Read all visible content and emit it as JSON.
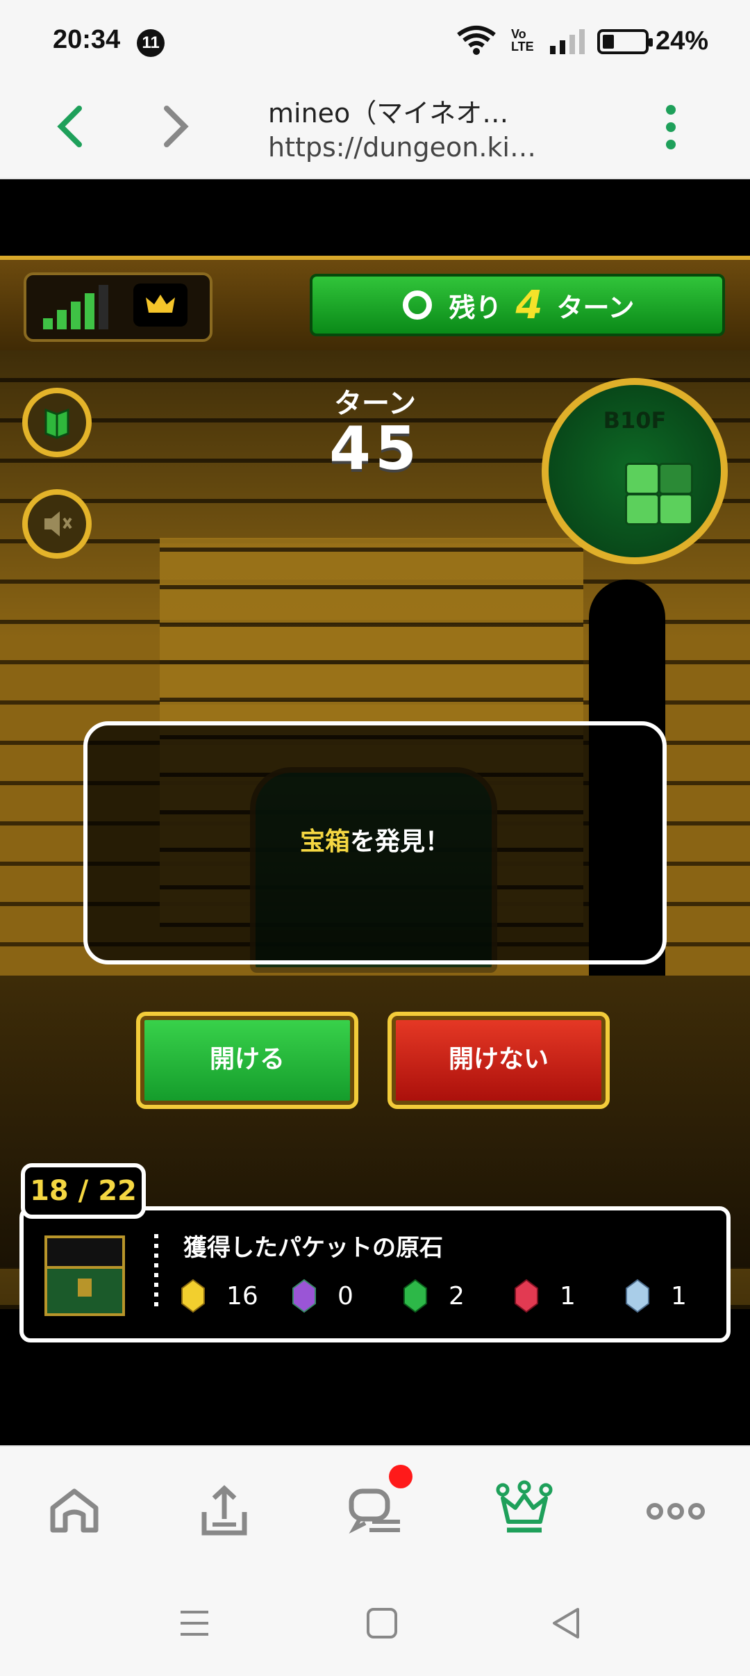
{
  "status_bar": {
    "time": "20:34",
    "notification_count": "11",
    "volte_label": "Vo\nLTE",
    "battery": "24%"
  },
  "browser": {
    "title": "mineo（マイネオ…",
    "url": "https://dungeon.ki…"
  },
  "game": {
    "remaining_label_prefix": "残り",
    "remaining_turns": "4",
    "remaining_label_suffix": "ターン",
    "turn_label": "ターン",
    "turn_number": "45",
    "floor": "B10F",
    "message_highlight": "宝箱",
    "message_rest": "を発見！",
    "open_button": "開ける",
    "not_open_button": "開けない",
    "chest_counter": "18 / 22",
    "gems_title": "獲得したパケットの原石",
    "gems": [
      {
        "name": "yellow-gem",
        "color": "#f2cf2e",
        "count": "16"
      },
      {
        "name": "purple-gem",
        "color": "#9a55d6",
        "count": "0"
      },
      {
        "name": "green-gem",
        "color": "#2db848",
        "count": "2"
      },
      {
        "name": "red-gem",
        "color": "#e23a52",
        "count": "1"
      },
      {
        "name": "blue-gem",
        "color": "#a9cde8",
        "count": "1"
      }
    ]
  },
  "nav": {
    "items": [
      "home-icon",
      "upload-tray-icon",
      "chat-icon",
      "crown-icon",
      "more-icon"
    ],
    "active_color": "#1ea05a"
  }
}
